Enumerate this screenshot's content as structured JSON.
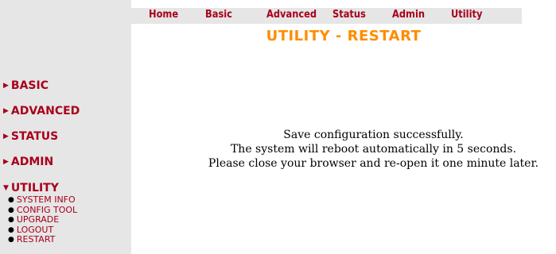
{
  "top_nav": {
    "items": [
      {
        "label": "Home"
      },
      {
        "label": "Basic"
      },
      {
        "label": "Advanced"
      },
      {
        "label": "Status"
      },
      {
        "label": "Admin"
      },
      {
        "label": "Utility"
      }
    ]
  },
  "page_title": "UTILITY - RESTART",
  "sidebar": {
    "sections": [
      {
        "label": "BASIC"
      },
      {
        "label": "ADVANCED"
      },
      {
        "label": "STATUS"
      },
      {
        "label": "ADMIN"
      },
      {
        "label": "UTILITY"
      }
    ],
    "utility_items": [
      {
        "label": "SYSTEM INFO"
      },
      {
        "label": "CONFIG TOOL"
      },
      {
        "label": "UPGRADE"
      },
      {
        "label": "LOGOUT"
      },
      {
        "label": "RESTART"
      }
    ]
  },
  "message": {
    "line1": "Save configuration successfully.",
    "line2": "The system will reboot automatically in 5 seconds.",
    "line3": "Please close your browser and re-open it one minute later."
  },
  "colors": {
    "nav_text": "#a8001b",
    "title": "#ff8c00",
    "sidebar_bg": "#e6e6e6"
  },
  "icons": {
    "collapsed_section": "triangle-right-icon",
    "expanded_section": "triangle-down-icon",
    "bullet": "bullet-dot-icon"
  }
}
